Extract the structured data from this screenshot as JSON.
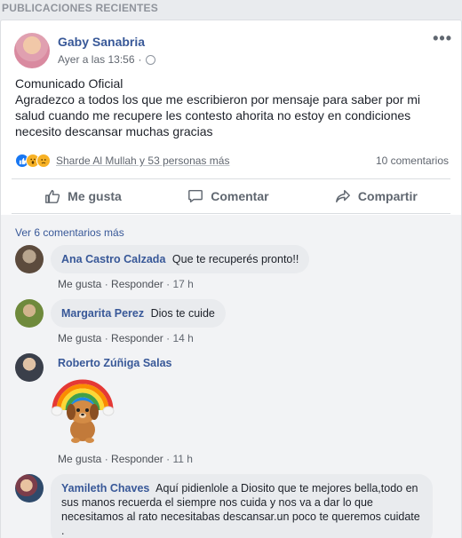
{
  "section_title": "PUBLICACIONES RECIENTES",
  "post": {
    "author": "Gaby Sanabria",
    "time": "Ayer a las 13:56",
    "more": "•••",
    "lines": [
      "Comunicado Oficial",
      "Agradezco a todos los que me escribieron por mensaje para saber por mi salud cuando me recupere les contesto ahorita no estoy en condiciones necesito descansar muchas gracias"
    ],
    "reactions_text": "Sharde Al Mullah y 53 personas más",
    "comments_count": "10 comentarios",
    "actions": {
      "like": "Me gusta",
      "comment": "Comentar",
      "share": "Compartir"
    }
  },
  "comments_section": {
    "view_more": "Ver 6 comentarios más",
    "like_label": "Me gusta",
    "reply_label": "Responder",
    "separator": "·",
    "items": [
      {
        "name": "Ana Castro Calzada",
        "text": "Que te recuperés pronto!!",
        "time": "17 h"
      },
      {
        "name": "Margarita Perez",
        "text": "Dios te cuide",
        "time": "14 h"
      },
      {
        "name": "Roberto Zúñiga Salas",
        "text": "",
        "time": "11 h"
      },
      {
        "name": "Yamileth Chaves",
        "text": "Aquí pidienlole a Diosito que te mejores bella,todo en sus manos recuerda el siempre nos cuida y nos va a dar lo que necesitamos al rato necesitabas descansar.un poco te queremos cuidate ."
      }
    ]
  },
  "colors": {
    "link": "#385898",
    "muted": "#616770",
    "bg": "#e9ebee",
    "like_blue": "#1877f2"
  }
}
